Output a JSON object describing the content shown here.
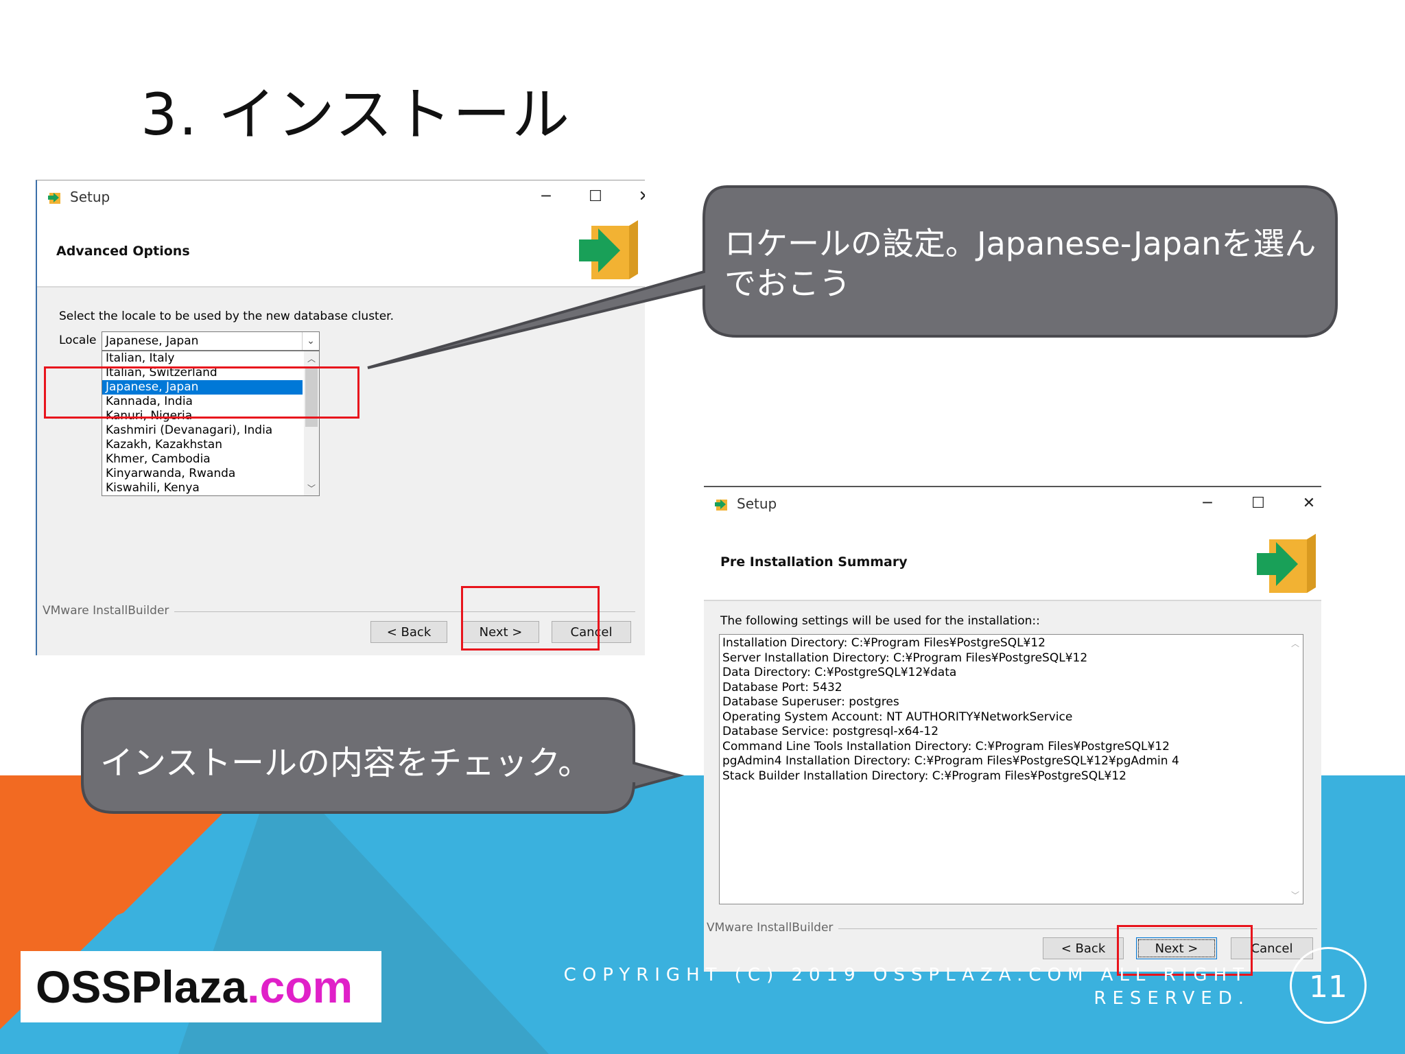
{
  "slide": {
    "title": "3.  インストール",
    "page_number": "11",
    "copyright_line1": "COPYRIGHT (C) 2019 OSSPLAZA.COM ALL RIGHT",
    "copyright_line2": "RESERVED.",
    "logo": {
      "main": "OSSPlaza",
      "suffix": ".com",
      "main_color": "#111111",
      "suffix_color": "#e020c8"
    },
    "colors": {
      "orange": "#f26a22",
      "blue": "#3ab1de",
      "callout": "#6e6e73"
    }
  },
  "callout_top": {
    "text_line1": "ロケールの設定。Japanese-Japanを選ん",
    "text_line2": "でおこう"
  },
  "callout_bottom": {
    "text": "インストールの内容をチェック。"
  },
  "dialog1": {
    "window_title": "Setup",
    "heading": "Advanced Options",
    "instruction": "Select the locale to be used by the new database cluster.",
    "locale_label": "Locale",
    "locale_selected": "Japanese, Japan",
    "locale_options": [
      "Italian, Italy",
      "Italian, Switzerland",
      "Japanese, Japan",
      "Kannada, India",
      "Kanuri, Nigeria",
      "Kashmiri (Devanagari), India",
      "Kazakh, Kazakhstan",
      "Khmer, Cambodia",
      "Kinyarwanda, Rwanda",
      "Kiswahili, Kenya"
    ],
    "footer_label": "VMware InstallBuilder",
    "back": "< Back",
    "next": "Next >",
    "cancel": "Cancel"
  },
  "dialog2": {
    "window_title": "Setup",
    "heading": "Pre Installation Summary",
    "instruction": "The following settings will be used for the installation::",
    "summary_lines": [
      "Installation Directory: C:¥Program Files¥PostgreSQL¥12",
      "Server Installation Directory: C:¥Program Files¥PostgreSQL¥12",
      "Data Directory: C:¥PostgreSQL¥12¥data",
      "Database Port: 5432",
      "Database Superuser: postgres",
      "Operating System Account: NT AUTHORITY¥NetworkService",
      "Database Service: postgresql-x64-12",
      "Command Line Tools Installation Directory: C:¥Program Files¥PostgreSQL¥12",
      "pgAdmin4 Installation Directory: C:¥Program Files¥PostgreSQL¥12¥pgAdmin 4",
      "Stack Builder Installation Directory: C:¥Program Files¥PostgreSQL¥12"
    ],
    "footer_label": "VMware InstallBuilder",
    "back": "< Back",
    "next": "Next >",
    "cancel": "Cancel"
  },
  "window_controls": {
    "minimize": "─",
    "maximize": "☐",
    "close": "✕"
  }
}
